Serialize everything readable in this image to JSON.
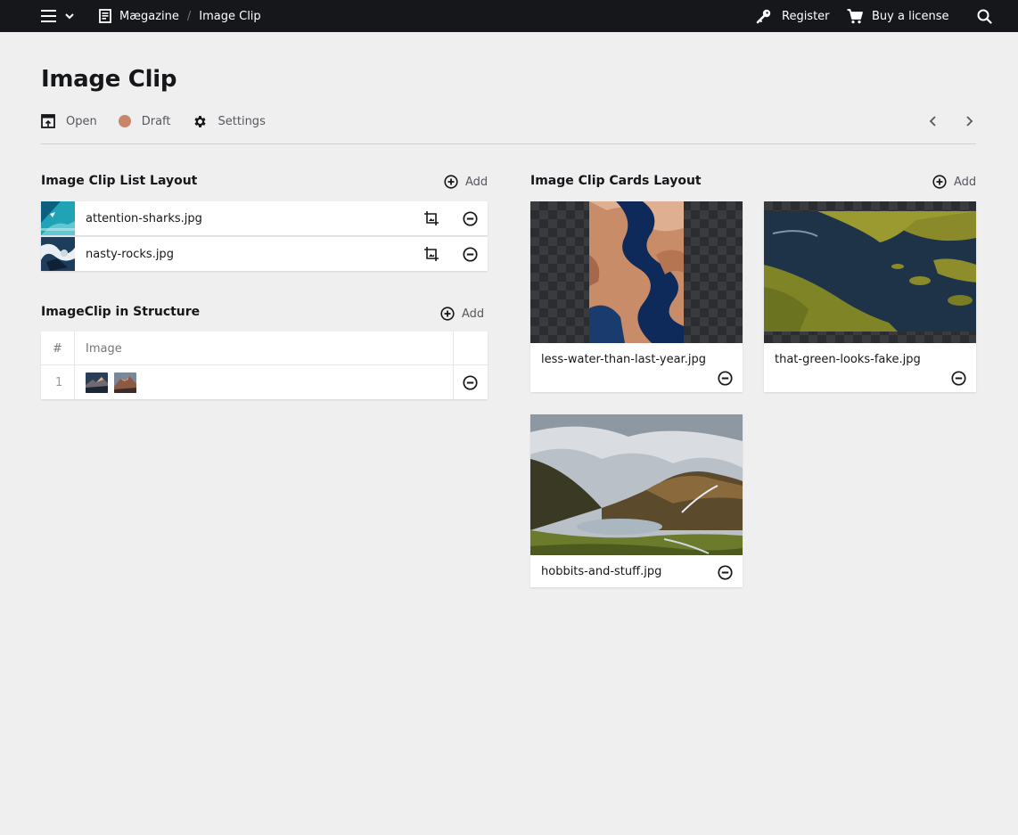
{
  "topbar": {
    "breadcrumb": [
      {
        "label": "Mægazine"
      },
      {
        "label": "Image Clip"
      }
    ],
    "register_label": "Register",
    "buy_label": "Buy a license"
  },
  "page": {
    "title": "Image Clip",
    "actions": {
      "open": "Open",
      "draft": "Draft",
      "settings": "Settings"
    },
    "status_color": "#c9866a"
  },
  "list_layout": {
    "title": "Image Clip List Layout",
    "add_label": "Add",
    "items": [
      {
        "name": "attention-sharks.jpg",
        "thumb": "ocean-aerial"
      },
      {
        "name": "nasty-rocks.jpg",
        "thumb": "rocks-waves"
      }
    ]
  },
  "structure": {
    "title": "ImageClip in Structure",
    "add_label": "Add",
    "columns": [
      "#",
      "Image"
    ],
    "rows": [
      {
        "index": "1",
        "thumbs": [
          "mountain-dusk",
          "mountain-warm"
        ]
      }
    ]
  },
  "cards_layout": {
    "title": "Image Clip Cards Layout",
    "add_label": "Add",
    "cards": [
      {
        "name": "less-water-than-last-year.jpg"
      },
      {
        "name": "that-green-looks-fake.jpg"
      },
      {
        "name": "hobbits-and-stuff.jpg"
      }
    ]
  }
}
